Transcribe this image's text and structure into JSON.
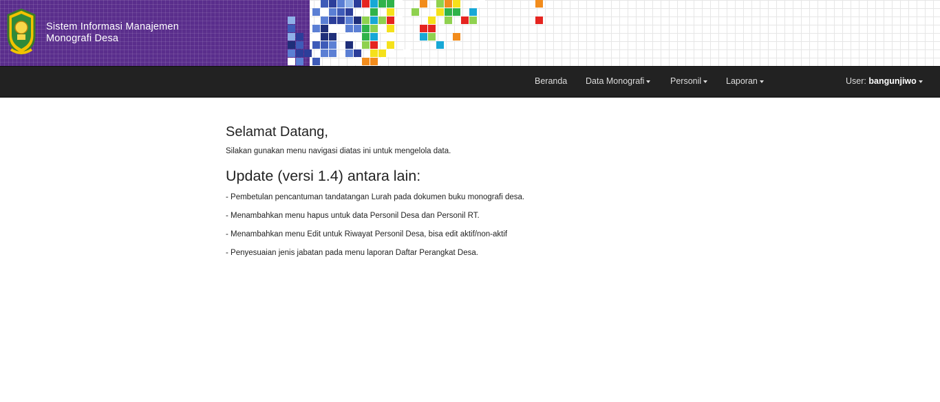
{
  "header": {
    "title_line1": "Sistem Informasi Manajemen",
    "title_line2": "Monografi Desa",
    "logo_icon": "village-emblem-icon"
  },
  "navbar": {
    "items": [
      {
        "label": "Beranda",
        "dropdown": false
      },
      {
        "label": "Data Monografi",
        "dropdown": true
      },
      {
        "label": "Personil",
        "dropdown": true
      },
      {
        "label": "Laporan",
        "dropdown": true
      }
    ],
    "user_prefix": "User:",
    "user_name": "bangunjiwo"
  },
  "main": {
    "welcome_title": "Selamat Datang,",
    "welcome_text": "Silakan gunakan menu navigasi diatas ini untuk mengelola data.",
    "update_title": "Update (versi 1.4) antara lain:",
    "updates": [
      "- Pembetulan pencantuman tandatangan Lurah pada dokumen buku monografi desa.",
      "- Menambahkan menu hapus untuk data Personil Desa dan Personil RT.",
      "- Menambahkan menu Edit untuk Riwayat Personil Desa, bisa edit aktif/non-aktif",
      "- Penyesuaian jenis jabatan pada menu laporan Daftar Perangkat Desa."
    ]
  },
  "colors": {
    "banner_purple": "#5a2e8c",
    "navbar_bg": "#222222",
    "nav_text": "#dddddd"
  }
}
